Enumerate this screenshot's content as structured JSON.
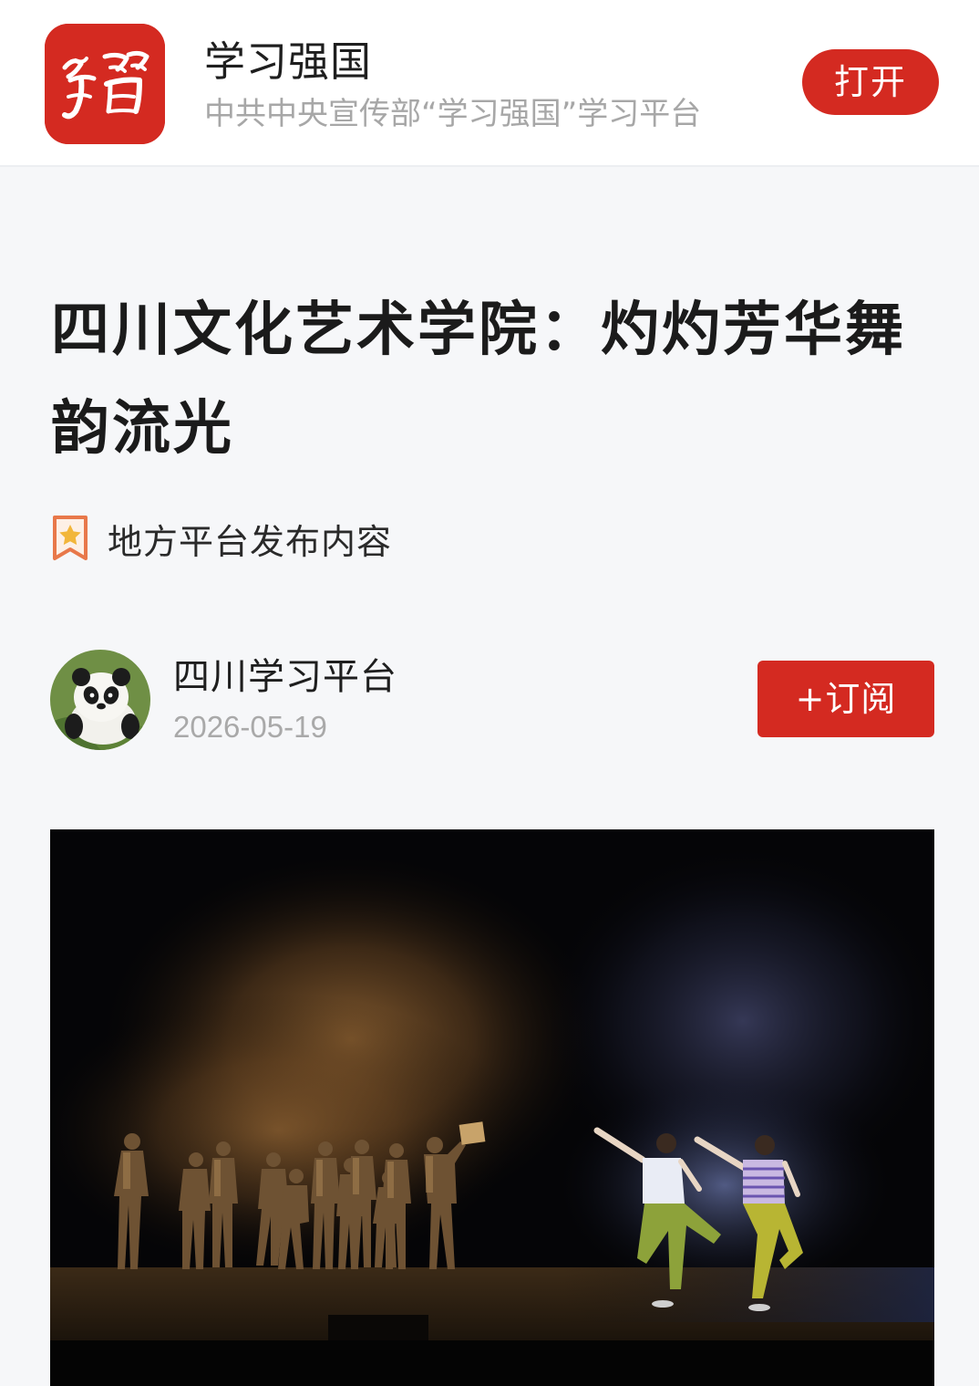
{
  "app_banner": {
    "app_name": "学习强国",
    "app_description": "中共中央宣传部“学习强国”学习平台",
    "logo_text": "學習",
    "open_label": "打开",
    "brand_color": "#d42a21"
  },
  "article": {
    "title": "四川文化艺术学院：灼灼芳华舞韵流光",
    "source_tag": "地方平台发布内容",
    "source_tag_icon": "bookmark-star-icon",
    "author": {
      "name": "四川学习平台",
      "date": "2026-05-19",
      "avatar": "panda-avatar"
    },
    "subscribe_label": "+订阅",
    "hero_image": "stage-dance-performance-photo"
  }
}
